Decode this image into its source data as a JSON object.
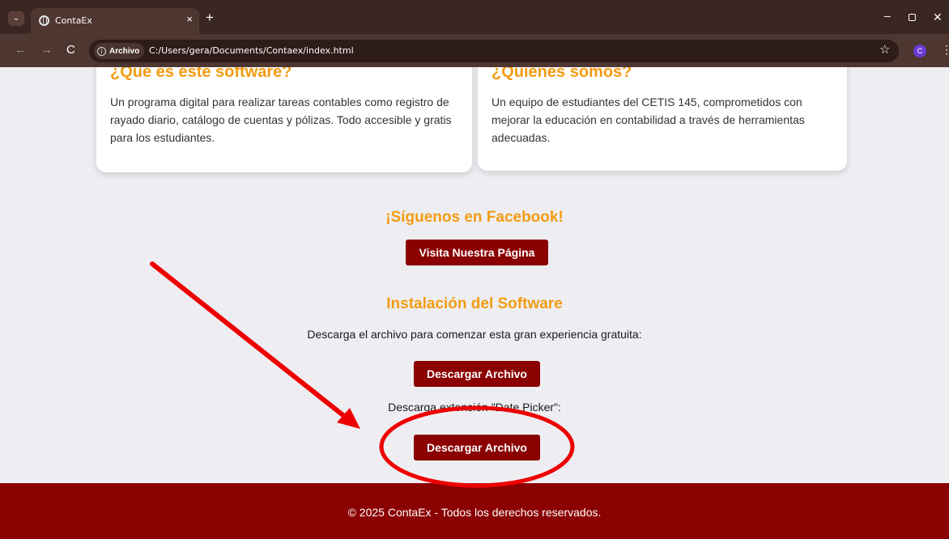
{
  "browser": {
    "tab_title": "ContaEx",
    "tab_close": "×",
    "new_tab": "+",
    "address_chip": "Archivo",
    "url": "C:/Users/gera/Documents/Contaex/index.html",
    "profile_initial": "C"
  },
  "cards": [
    {
      "title": "¿Qué es este software?",
      "text": "Un programa digital para realizar tareas contables como registro de rayado diario, catálogo de cuentas y pólizas. Todo accesible y gratis para los estudiantes."
    },
    {
      "title": "¿Quiénes somos?",
      "text": "Un equipo de estudiantes del CETIS 145, comprometidos con mejorar la educación en contabilidad a través de herramientas adecuadas."
    }
  ],
  "facebook": {
    "title": "¡Síguenos en Facebook!",
    "button": "Visita Nuestra Página"
  },
  "install": {
    "title": "Instalación del Software",
    "description": "Descarga el archivo para comenzar esta gran experiencia gratuita:",
    "download_button": "Descargar Archivo",
    "extension_text": "Descarga extensión \"Date Picker\":",
    "extension_button": "Descargar Archivo"
  },
  "footer": {
    "text": "© 2025 ContaEx - Todos los derechos reservados."
  },
  "colors": {
    "accent_orange": "#f39c12",
    "brand_maroon": "#8b0000",
    "annotation_red": "#ee0000"
  },
  "icons": [
    "tab-menu-icon",
    "globe-icon",
    "back-icon",
    "forward-icon",
    "reload-icon",
    "info-icon",
    "star-icon",
    "kebab-icon"
  ]
}
